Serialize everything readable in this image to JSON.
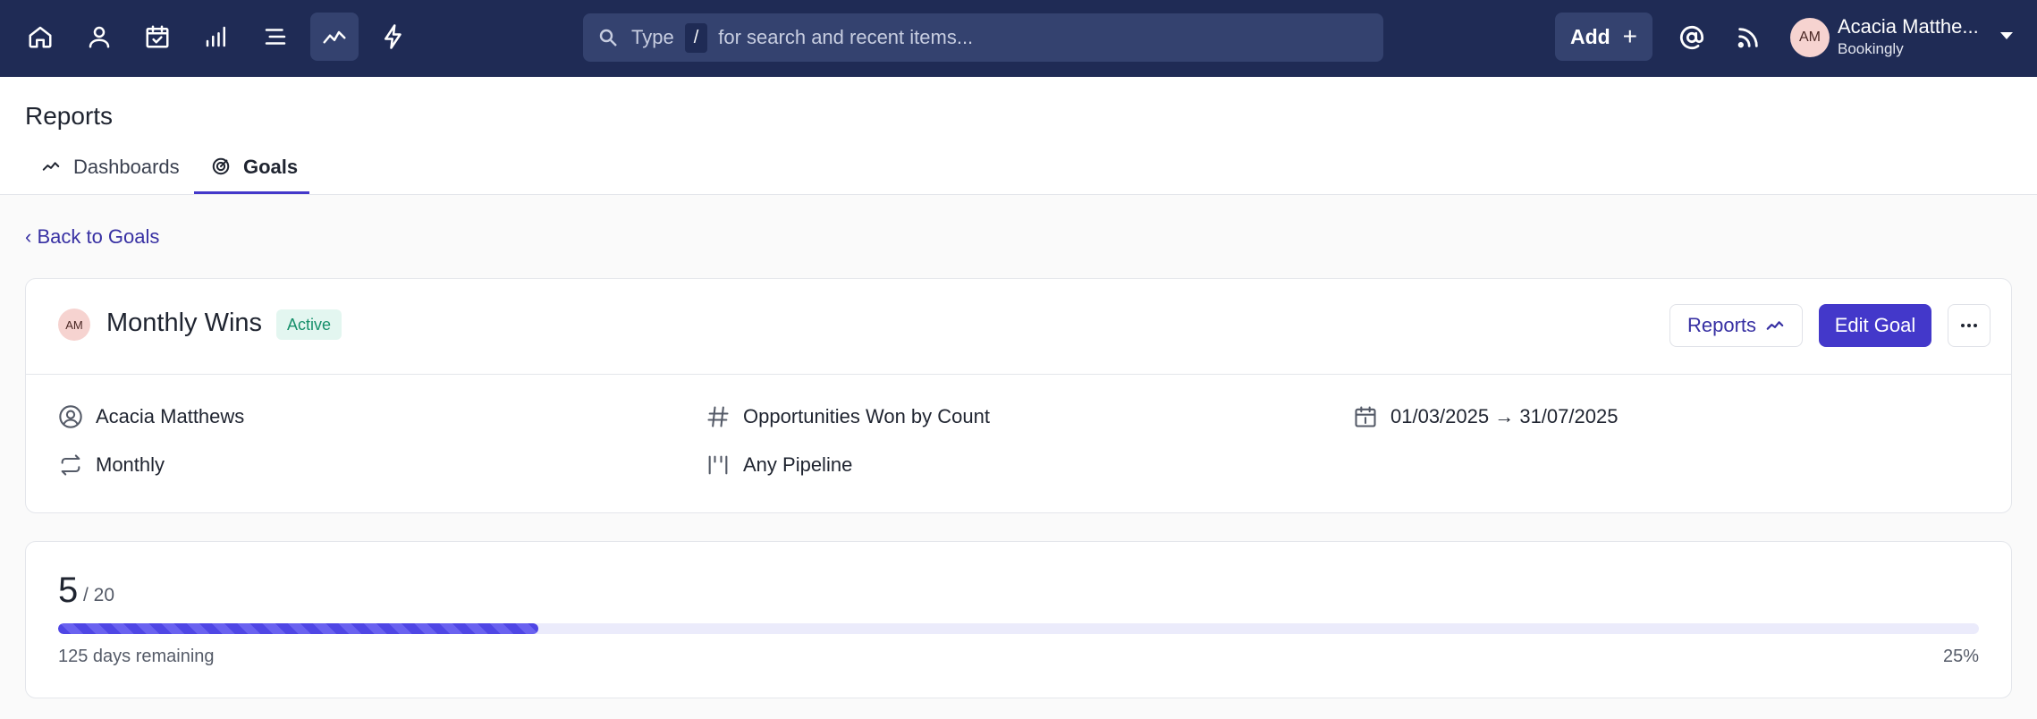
{
  "topbar": {
    "search": {
      "prefix": "Type",
      "shortcut": "/",
      "suffix": "for search and recent items..."
    },
    "add_label": "Add",
    "user": {
      "initials": "AM",
      "name": "Acacia Matthe...",
      "org": "Bookingly"
    }
  },
  "page": {
    "title": "Reports",
    "tabs": [
      {
        "label": "Dashboards",
        "active": false
      },
      {
        "label": "Goals",
        "active": true
      }
    ],
    "back_link": "‹ Back to Goals"
  },
  "goal": {
    "owner_initials": "AM",
    "title": "Monthly Wins",
    "status": "Active",
    "reports_label": "Reports",
    "edit_label": "Edit Goal",
    "meta": {
      "owner": "Acacia Matthews",
      "metric": "Opportunities Won by Count",
      "date_range": "01/03/2025 → 31/07/2025",
      "interval": "Monthly",
      "pipeline": "Any Pipeline"
    }
  },
  "progress": {
    "current": "5",
    "target": "/ 20",
    "fraction": 0.25,
    "remaining": "125 days remaining",
    "percent": "25%"
  },
  "colors": {
    "nav_bg": "#1f2b55",
    "accent": "#4338ca",
    "status_green": "#17906b"
  }
}
